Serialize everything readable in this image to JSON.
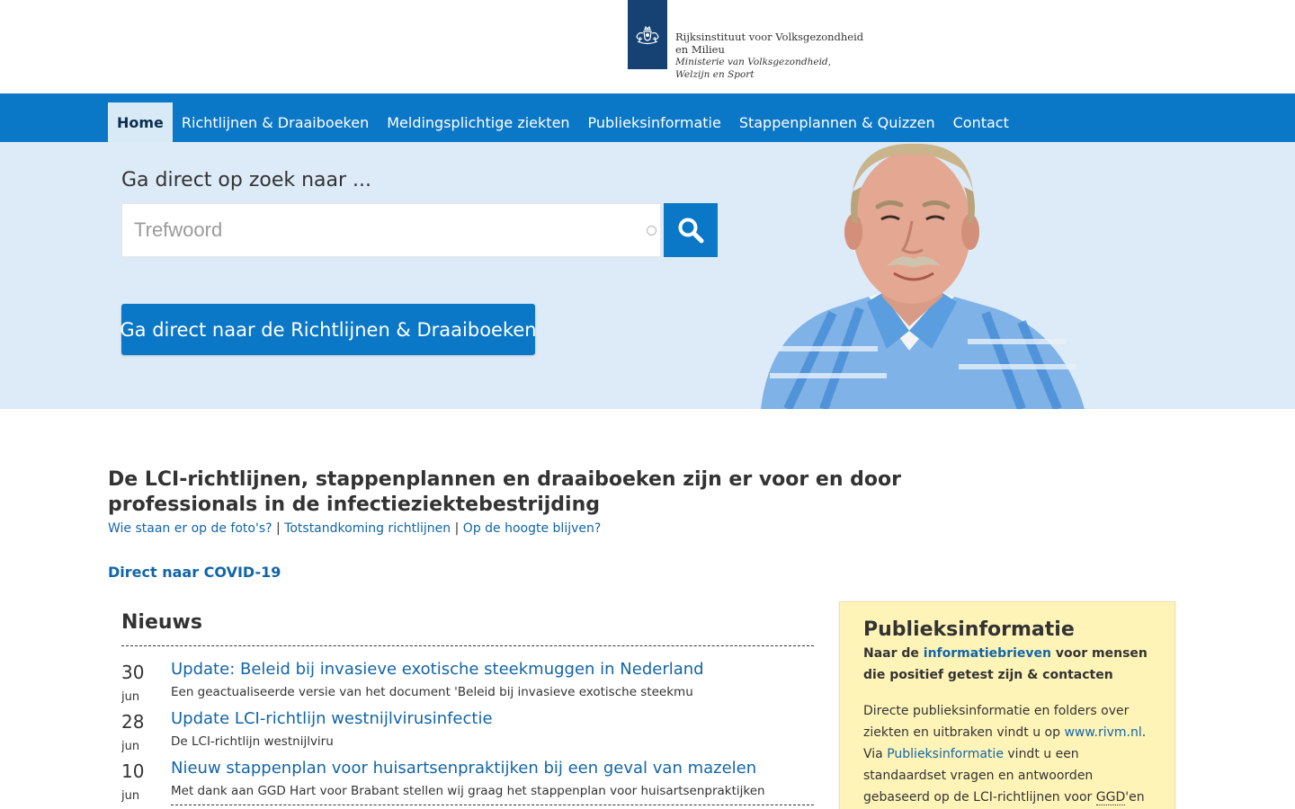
{
  "header": {
    "org_name": "Rijksinstituut voor Volksgezondheid en Milieu",
    "ministry": "Ministerie van Volksgezondheid, Welzijn en Sport"
  },
  "nav": {
    "items": [
      {
        "label": "Home",
        "active": true
      },
      {
        "label": "Richtlijnen & Draaiboeken"
      },
      {
        "label": "Meldingsplichtige ziekten"
      },
      {
        "label": "Publieksinformatie"
      },
      {
        "label": "Stappenplannen & Quizzen"
      },
      {
        "label": "Contact"
      }
    ]
  },
  "hero": {
    "title": "Ga direct op zoek naar ...",
    "search_placeholder": "Trefwoord",
    "cta_label": "Ga direct naar de Richtlijnen & Draaiboeken"
  },
  "intro": {
    "title": "De LCI-richtlijnen, stappenplannen en draaiboeken zijn er voor en door professionals in de infectieziektebestrijding",
    "links": [
      "Wie staan er op de foto's?",
      "Totstandkoming richtlijnen",
      "Op de hoogte blijven?"
    ],
    "separator": "|",
    "covid_link": "Direct naar COVID-19"
  },
  "news": {
    "heading": "Nieuws",
    "items": [
      {
        "day": "30",
        "month": "jun",
        "title": "Update: Beleid bij invasieve exotische steekmuggen in Nederland",
        "excerpt": "Een geactualiseerde versie van het document 'Beleid bij invasieve exotische steekmu"
      },
      {
        "day": "28",
        "month": "jun",
        "title": "Update LCI-richtlijn westnijlvirusinfectie",
        "excerpt": "De LCI-richtlijn westnijlviru"
      },
      {
        "day": "10",
        "month": "jun",
        "title": "Nieuw stappenplan voor huisartsenpraktijken bij een geval van mazelen",
        "excerpt": "Met dank aan GGD Hart voor Brabant stellen wij graag het stappenplan voor huisartsenpraktijken"
      }
    ]
  },
  "sidebar": {
    "title": "Publieksinformatie",
    "lead_pre": "Naar de ",
    "lead_link": "informatiebrieven",
    "lead_post": " voor mensen die positief getest zijn & contacten",
    "body_1": "Directe publieksinformatie en folders over ziekten en uitbraken vindt u op ",
    "body_link_1": "www.rivm.nl",
    "body_2": ". Via ",
    "body_link_2": "Publieksinformatie",
    "body_3": " vindt u een standaardset vragen en antwoorden gebaseerd op de LCI-richtlijnen voor ",
    "body_abbr": "GGD",
    "body_4": "'en om te gebruiken bij het"
  },
  "icons": {
    "logo": "rijksoverheid-emblem-icon",
    "search": "search-icon"
  },
  "colors": {
    "primary_blue": "#0b77c7",
    "logo_blue": "#154273",
    "hero_bg": "#dcebf7",
    "link": "#1265a8",
    "sidebar_bg": "#fff4b8"
  }
}
